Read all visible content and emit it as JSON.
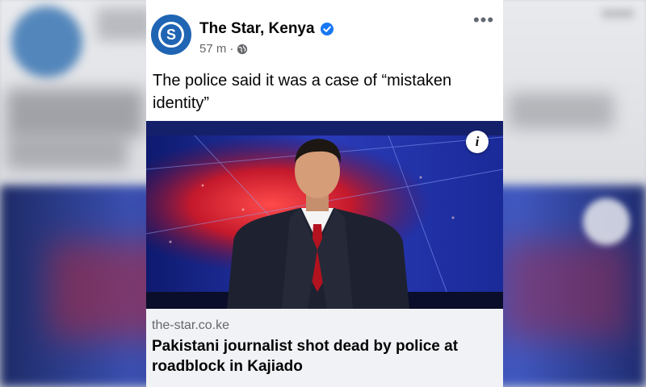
{
  "post": {
    "page_name": "The Star, Kenya",
    "avatar_letter": "S",
    "time": "57 m",
    "separator": "·",
    "text": "The police said it was a case of “mistaken identity”",
    "more_label": "•••"
  },
  "link_preview": {
    "domain": "the-star.co.ke",
    "headline": "Pakistani journalist shot dead by police at roadblock in Kajiado",
    "info_label": "i"
  },
  "icons": {
    "verified": "verified-badge-icon",
    "globe": "globe-icon",
    "more": "more-options-icon",
    "info": "info-icon"
  },
  "colors": {
    "brand_blue": "#1f65b3",
    "verified_blue": "#1877f2",
    "studio_blue": "#1b2a8a",
    "studio_red": "#c4192c",
    "tie_red": "#b3121f"
  }
}
